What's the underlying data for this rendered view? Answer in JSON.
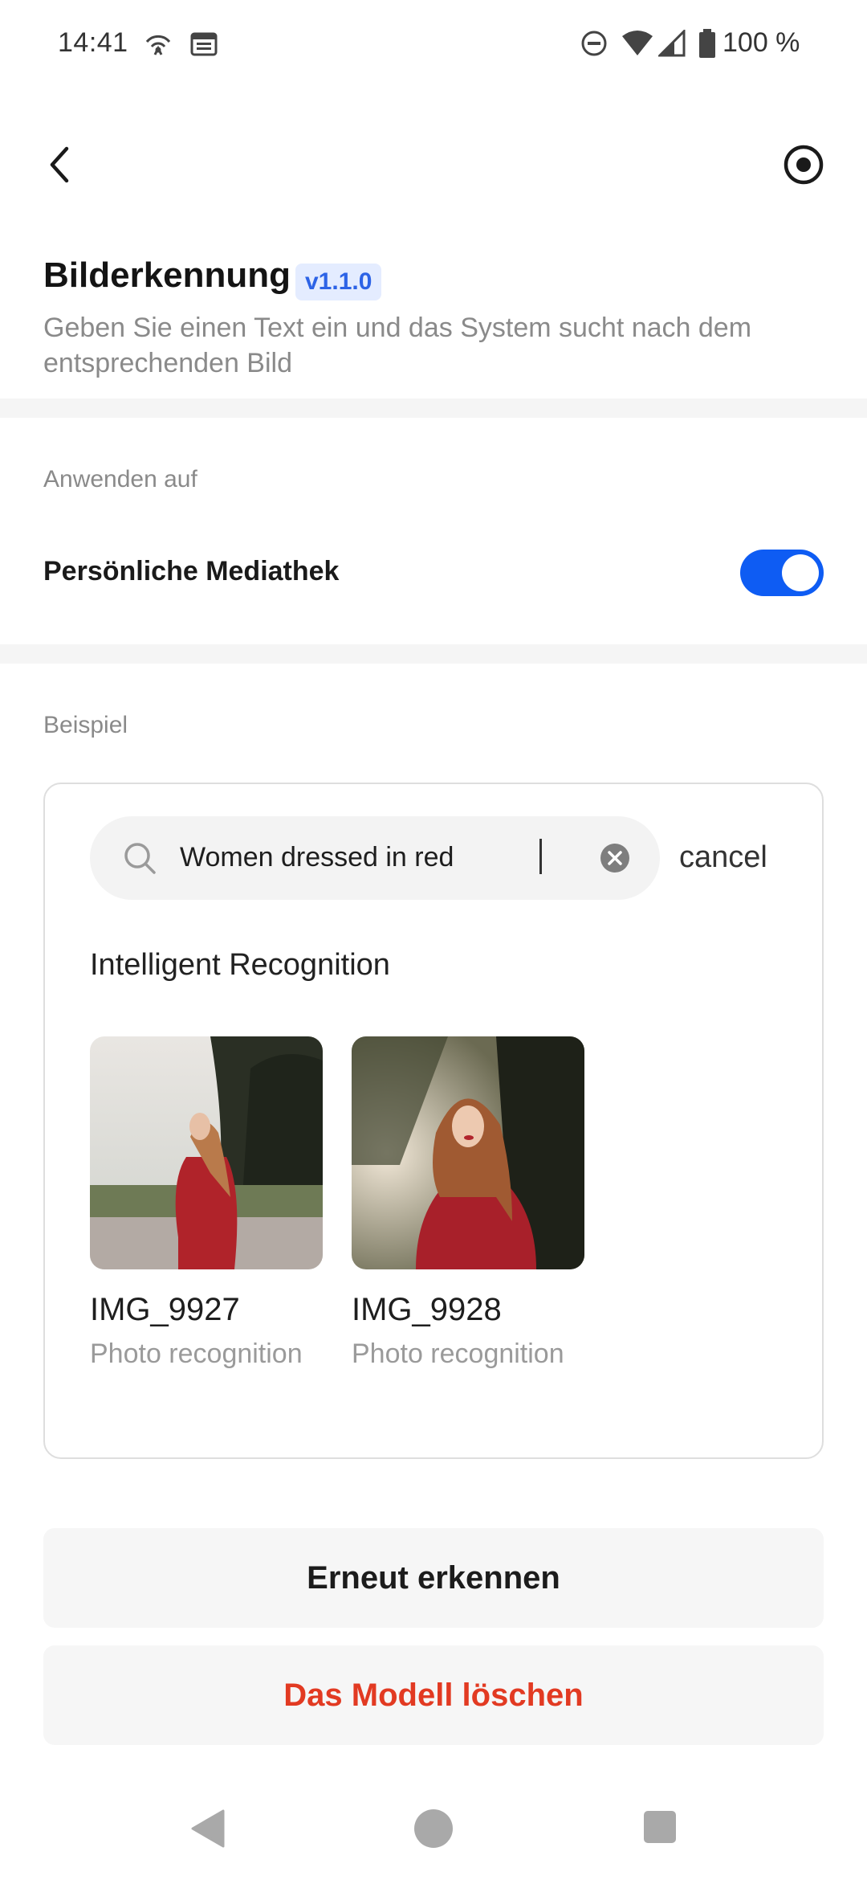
{
  "status_bar": {
    "time": "14:41",
    "battery_percent": "100 %",
    "icons": [
      "hotspot-icon",
      "calendar-icon",
      "dnd-icon",
      "wifi-icon",
      "signal-icon",
      "battery-icon"
    ]
  },
  "header": {
    "back_icon": "chevron-left-icon",
    "record_icon": "record-icon",
    "title": "Bilderkennung",
    "version": "v1.1.0",
    "subtitle": "Geben Sie einen Text ein und das System sucht nach dem entsprechenden Bild"
  },
  "apply_section": {
    "label": "Anwenden auf",
    "item_label": "Persönliche Mediathek",
    "toggle_on": true
  },
  "example_section": {
    "label": "Beispiel",
    "search": {
      "query": "Women dressed in red",
      "cancel_label": "cancel"
    },
    "results_title": "Intelligent Recognition",
    "results": [
      {
        "name": "IMG_9927",
        "subtitle": "Photo recognition"
      },
      {
        "name": "IMG_9928",
        "subtitle": "Photo recognition"
      }
    ]
  },
  "actions": {
    "recognize_again": "Erneut erkennen",
    "delete_model": "Das Modell löschen"
  },
  "colors": {
    "accent": "#0e5cf3",
    "danger": "#e23a22",
    "badge_bg": "#e4ecff",
    "badge_text": "#2d63e6"
  }
}
